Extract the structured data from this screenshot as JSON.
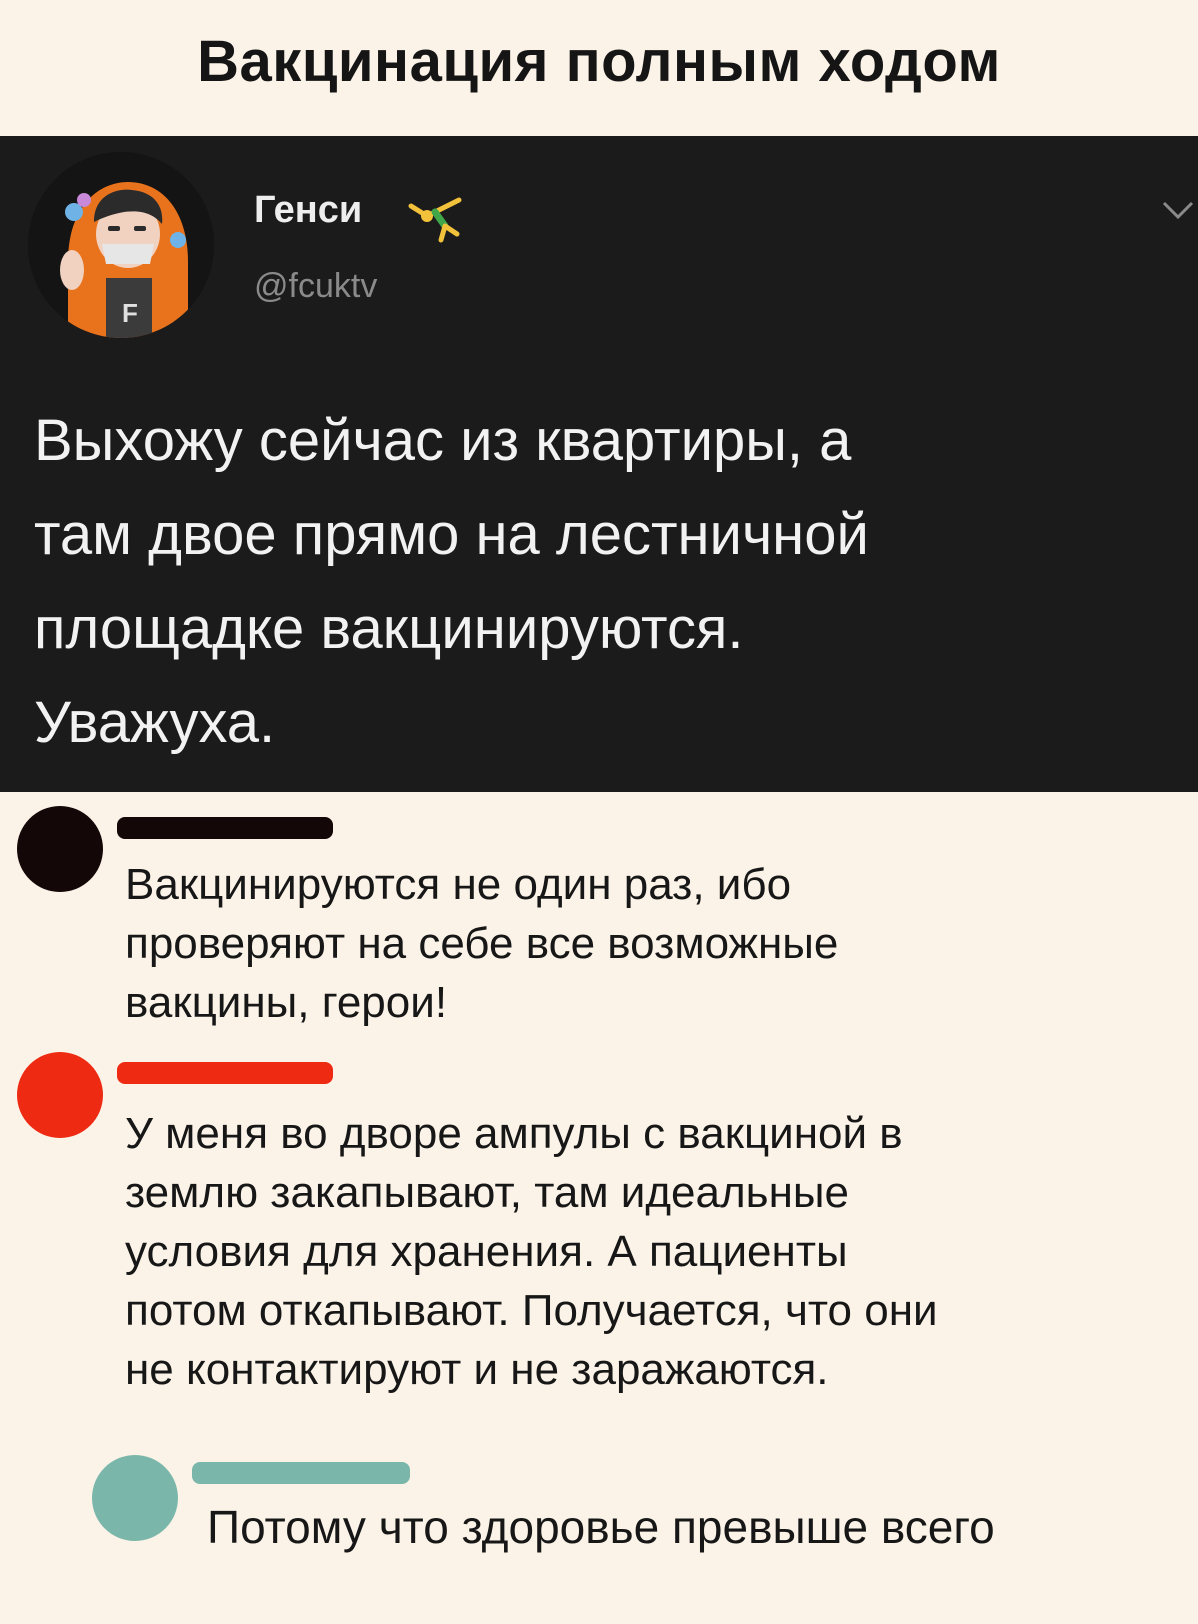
{
  "title": "Вакцинация полным ходом",
  "tweet": {
    "display_name": "Генси",
    "emoji": "person-cartwheeling",
    "handle": "@fcuktv",
    "text_lines": [
      "Выхожу сейчас из квартиры, а",
      "там двое прямо на лестничной",
      "площадке вакцинируются.",
      "Уважуха."
    ]
  },
  "comments": [
    {
      "avatar_color": "#140707",
      "bar_color": "#140707",
      "lines": [
        "Вакцинируются не один раз, ибо",
        "проверяют на себе все возможные",
        "вакцины, герои!"
      ]
    },
    {
      "avatar_color": "#ee2a12",
      "bar_color": "#ee2a12",
      "lines": [
        "У меня во дворе ампулы с вакциной в",
        "землю закапывают, там идеальные",
        "условия для хранения. А пациенты",
        "потом откапывают. Получается, что они",
        "не контактируют и не заражаются."
      ]
    },
    {
      "avatar_color": "#7ab7aa",
      "bar_color": "#7ab7aa",
      "lines": [
        "Потому что здоровье превыше всего"
      ]
    }
  ]
}
